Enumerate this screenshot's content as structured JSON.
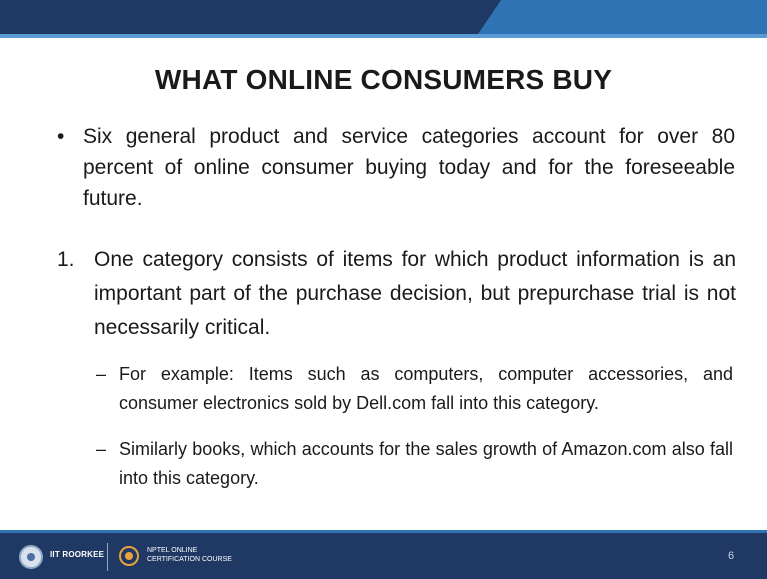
{
  "slide": {
    "title": "WHAT ONLINE CONSUMERS BUY",
    "bullet_symbol": "•",
    "bullet_text": "Six general product and service categories account for over 80 percent of online consumer buying today and for the foreseeable future.",
    "numbered_marker": "1.",
    "numbered_text": "One category consists of items for which product information is an important part of the purchase decision, but prepurchase trial is not necessarily critical.",
    "sub_marker": "–",
    "sub_items": [
      "For example: Items such as computers, computer accessories, and consumer electronics sold by Dell.com fall into this category.",
      "Similarly books, which accounts for the sales growth of Amazon.com also fall into this category."
    ]
  },
  "footer": {
    "institute": "IIT ROORKEE",
    "course_line1": "NPTEL ONLINE",
    "course_line2": "CERTIFICATION COURSE",
    "page_number": "6"
  },
  "colors": {
    "banner": "#203864",
    "accent": "#2e74b5",
    "light_accent": "#5b9bd5"
  }
}
